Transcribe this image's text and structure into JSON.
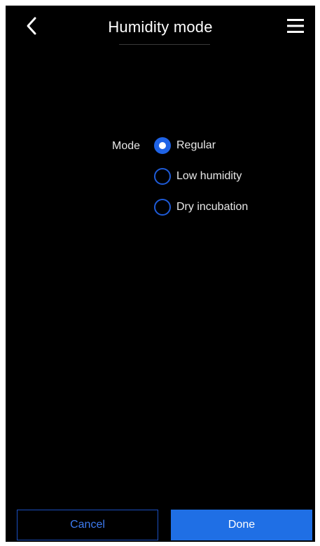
{
  "header": {
    "title": "Humidity mode",
    "back_icon": "chevron-left-icon",
    "menu_icon": "hamburger-menu-icon"
  },
  "form": {
    "mode_label": "Mode",
    "selected": "Regular",
    "options": [
      {
        "label": "Regular",
        "checked": true
      },
      {
        "label": "Low humidity",
        "checked": false
      },
      {
        "label": "Dry incubation",
        "checked": false
      }
    ]
  },
  "footer": {
    "cancel_label": "Cancel",
    "done_label": "Done"
  },
  "colors": {
    "background": "#000000",
    "accent": "#1f6fe5",
    "text": "#e8e8e8"
  }
}
